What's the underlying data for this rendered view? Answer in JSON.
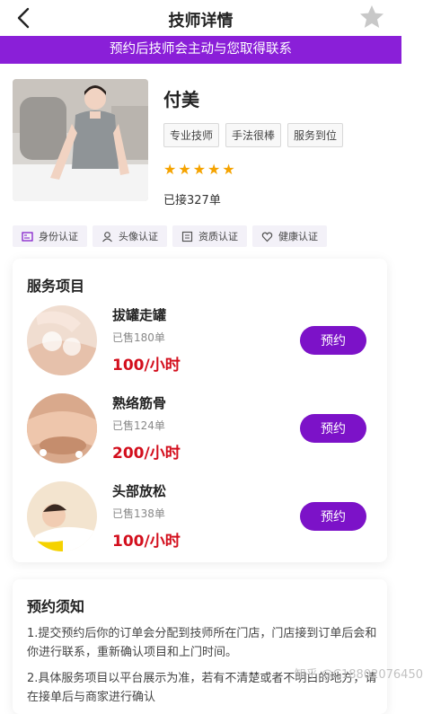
{
  "header": {
    "title": "技师详情",
    "back_icon": "chevron-left-icon",
    "favorite_icon": "star-icon"
  },
  "banner": {
    "text": "预约后技师会主动与您取得联系"
  },
  "profile": {
    "name": "付美",
    "tags": [
      "专业技师",
      "手法很棒",
      "服务到位"
    ],
    "rating_stars": 5,
    "orders": "已接327单"
  },
  "certifications": [
    {
      "label": "身份认证",
      "icon": "id-card-icon"
    },
    {
      "label": "头像认证",
      "icon": "user-icon"
    },
    {
      "label": "资质认证",
      "icon": "certificate-icon"
    },
    {
      "label": "健康认证",
      "icon": "heart-icon"
    }
  ],
  "services": {
    "title": "服务项目",
    "items": [
      {
        "name": "拔罐走罐",
        "sold": "已售180单",
        "price": "100/小时",
        "button": "预约"
      },
      {
        "name": "熟络筋骨",
        "sold": "已售124单",
        "price": "200/小时",
        "button": "预约"
      },
      {
        "name": "头部放松",
        "sold": "已售138单",
        "price": "100/小时",
        "button": "预约"
      }
    ]
  },
  "notice": {
    "title": "预约须知",
    "paragraphs": [
      "1.提交预约后你的订单会分配到技师所在门店，门店接到订单后会和你进行联系，重新确认项目和上门时间。",
      "2.具体服务项目以平台展示为准，若有不清楚或者不明白的地方，请在接单后与商家进行确认"
    ]
  },
  "watermark": "知乎 @C18802076450",
  "colors": {
    "accent": "#8a1fd8",
    "button": "#7c12c8",
    "price": "#d30f1d",
    "star": "#f5a300"
  }
}
